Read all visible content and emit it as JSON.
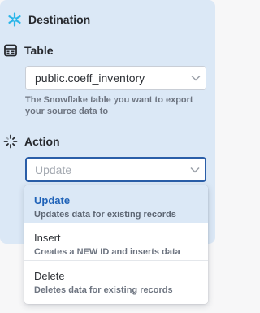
{
  "destination": {
    "heading": "Destination",
    "icon": "snowflake-icon"
  },
  "table": {
    "heading": "Table",
    "icon": "table-icon",
    "selected": "public.coeff_inventory",
    "hint": "The Snowflake table you want to export your source data to"
  },
  "action": {
    "heading": "Action",
    "icon": "loading-spinner-icon",
    "placeholder": "Update",
    "options": [
      {
        "label": "Update",
        "description": "Updates data for existing records",
        "selected": true
      },
      {
        "label": "Insert",
        "description": "Creates a NEW ID and inserts data",
        "selected": false
      },
      {
        "label": "Delete",
        "description": "Deletes data for existing records",
        "selected": false
      }
    ]
  },
  "colors": {
    "accent": "#1f62b8",
    "panel_bg": "#dbe8f6",
    "snowflake": "#29b5e8"
  }
}
